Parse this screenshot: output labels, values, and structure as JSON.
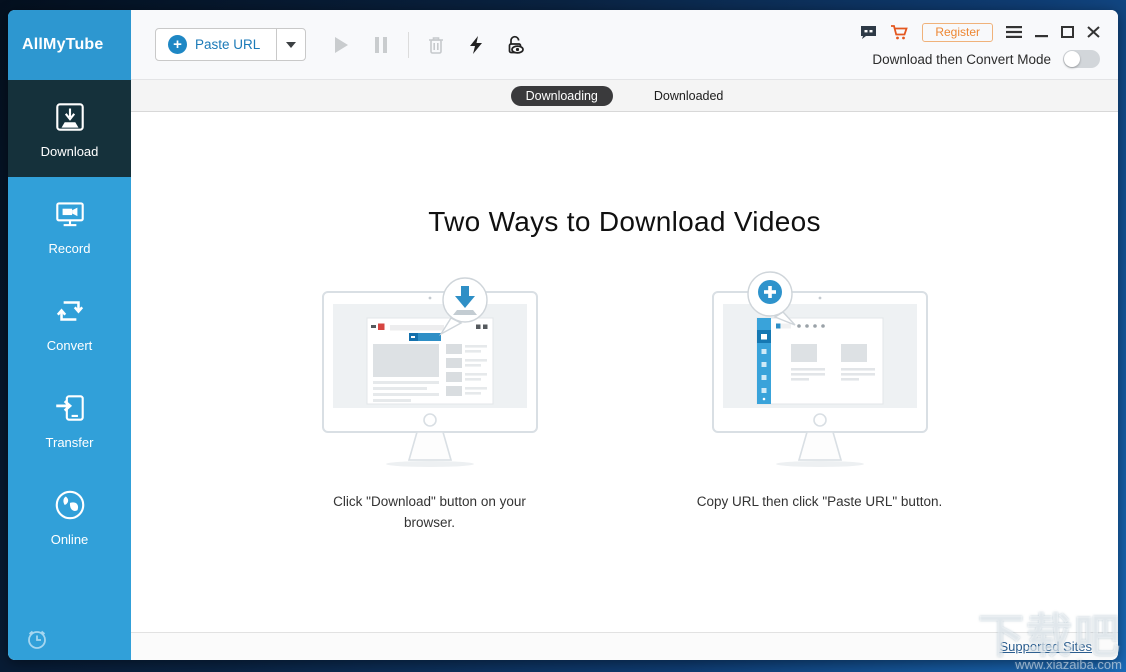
{
  "app_name": "AllMyTube",
  "titlebar": {
    "register_label": "Register",
    "mode_toggle_label": "Download then Convert Mode",
    "mode_toggle_state": "off"
  },
  "toolbar": {
    "paste_url_label": "Paste URL",
    "icons": [
      "play",
      "pause",
      "delete",
      "lightning",
      "private-download"
    ]
  },
  "tabs": [
    {
      "label": "Downloading",
      "active": true
    },
    {
      "label": "Downloaded",
      "active": false
    }
  ],
  "sidebar": {
    "items": [
      {
        "label": "Download",
        "icon": "download-icon",
        "active": true
      },
      {
        "label": "Record",
        "icon": "record-icon",
        "active": false
      },
      {
        "label": "Convert",
        "icon": "convert-icon",
        "active": false
      },
      {
        "label": "Transfer",
        "icon": "transfer-icon",
        "active": false
      },
      {
        "label": "Online",
        "icon": "online-icon",
        "active": false
      }
    ]
  },
  "main": {
    "title": "Two Ways to Download Videos",
    "methods": [
      {
        "caption": "Click \"Download\" button on your browser."
      },
      {
        "caption": "Copy URL then click \"Paste URL\" button."
      }
    ]
  },
  "footer": {
    "supported_sites_label": "Supported Sites"
  },
  "watermark": {
    "text": "下载吧",
    "url": "www.xiazaiba.com"
  },
  "colors": {
    "sidebar_blue": "#31a0d9",
    "active_item_dark": "#15313b",
    "accent_blue": "#1e87c4",
    "register_orange": "#ed8733",
    "cart_orange": "#e4571f",
    "tab_pill_dark": "#3a3a3c"
  }
}
